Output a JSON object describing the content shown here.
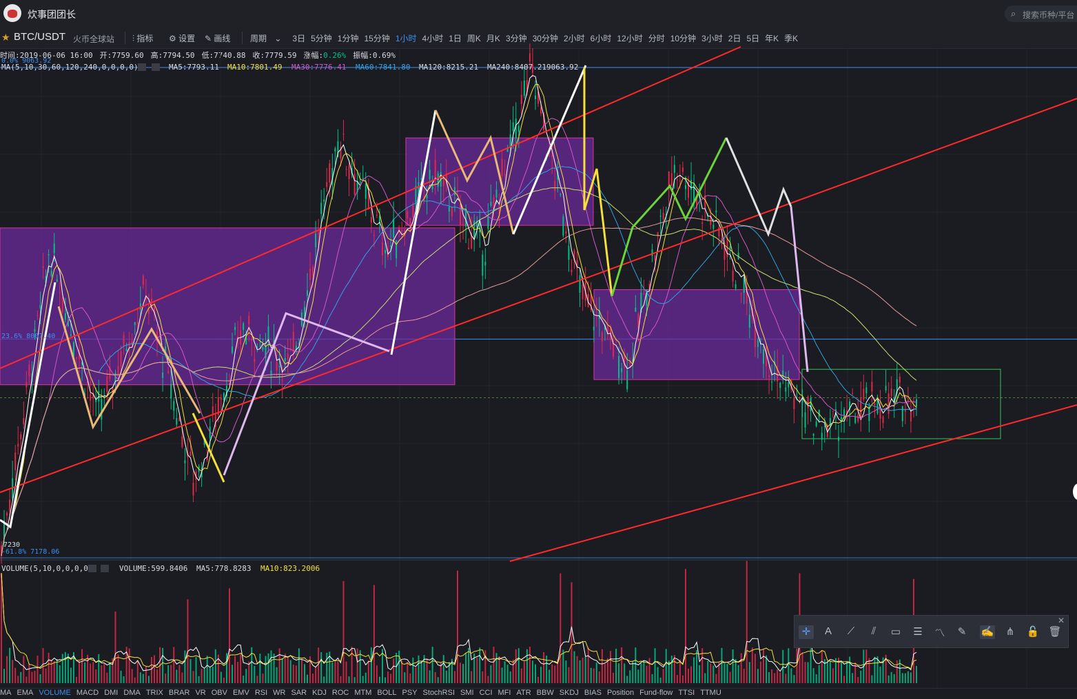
{
  "app": {
    "title": "炊事团团长",
    "search_placeholder": "搜索币种/平台"
  },
  "toolbar": {
    "pair": "BTC/USDT",
    "exchange": "火币全球站",
    "indicators_label": "指标",
    "settings_label": "设置",
    "draw_label": "画线",
    "period_label": "周期",
    "periods": [
      "3日",
      "5分钟",
      "1分钟",
      "15分钟",
      "1小时",
      "4小时",
      "1日",
      "周K",
      "月K",
      "3分钟",
      "30分钟",
      "2小时",
      "6小时",
      "12小时",
      "分时",
      "10分钟",
      "3小时",
      "2日",
      "5日",
      "年K",
      "季K"
    ],
    "active_period": "1小时"
  },
  "info": {
    "time": "时间:2019-06-06 16:00",
    "open_label": "开:",
    "open": "7759.60",
    "high_label": "高:",
    "high": "7794.50",
    "low_label": "低:",
    "low": "7740.88",
    "close_label": "收:",
    "close": "7779.59",
    "change_label": "涨幅:",
    "change": "0.26%",
    "amp_label": "振幅:",
    "amp": "0.69%",
    "ma_params": "MA(5,10,30,60,120,240,0,0,0,0)",
    "ma5": "MA5:7793.11",
    "ma10": "MA10:7801.49",
    "ma30": "MA30:7776.41",
    "ma60": "MA60:7841.80",
    "ma120": "MA120:8215.21",
    "ma240": "MA240:8407.21"
  },
  "levels": {
    "fib_top": "0.0% 9063.92",
    "top_price": "9063.92",
    "fib_mid": "23.6% 8007.40",
    "low_mark": "7230",
    "fib_bottom": "-61.8% 7178.06"
  },
  "volume": {
    "params": "VOLUME(5,10,0,0,0,0)",
    "volume": "VOLUME:599.8406",
    "ma5": "MA5:778.8283",
    "ma10": "MA10:823.2006"
  },
  "indicators": [
    "MA",
    "EMA",
    "VOLUME",
    "MACD",
    "DMI",
    "DMA",
    "TRIX",
    "BRAR",
    "VR",
    "OBV",
    "EMV",
    "RSI",
    "WR",
    "SAR",
    "KDJ",
    "ROC",
    "MTM",
    "BOLL",
    "PSY",
    "StochRSI",
    "SMI",
    "CCI",
    "MFI",
    "ATR",
    "BBW",
    "SKDJ",
    "BIAS",
    "Position",
    "Fund-flow",
    "TTSI",
    "TTMU"
  ],
  "active_indicator": "VOLUME",
  "colors": {
    "background": "#1a1c21",
    "up": "#03c087",
    "down": "#e0294a",
    "ma5": "#ffffff",
    "ma10": "#f5e03c",
    "ma30": "#d456c9",
    "ma60": "#2fa4e0",
    "ma120": "#c8e070",
    "ma240": "#e89a9a",
    "trend": "#ff2a2a",
    "zone": "#6b2a9c",
    "accent": "#3d8ff2"
  },
  "chart_data": {
    "type": "candlestick",
    "pair": "BTC/USDT",
    "interval": "1小时",
    "ohlc_last": {
      "open": 7759.6,
      "high": 7794.5,
      "low": 7740.88,
      "close": 7779.59
    },
    "moving_averages": {
      "MA5": 7793.11,
      "MA10": 7801.49,
      "MA30": 7776.41,
      "MA60": 7841.8,
      "MA120": 8215.21,
      "MA240": 8407.21
    },
    "y_range": [
      7178.06,
      9063.92
    ],
    "fib_levels": [
      {
        "level": "0.0%",
        "price": 9063.92
      },
      {
        "level": "23.6%",
        "price": 8007.4
      },
      {
        "level": "-61.8%",
        "price": 7178.06
      }
    ],
    "zones": [
      {
        "color": "purple",
        "price_top": 8440,
        "price_bottom": 7830
      },
      {
        "color": "purple",
        "price_top": 8790,
        "price_bottom": 8450
      },
      {
        "color": "purple",
        "price_top": 8200,
        "price_bottom": 7850
      },
      {
        "color": "green",
        "price_top": 7890,
        "price_bottom": 7620
      }
    ],
    "close_path": [
      7200,
      8350,
      7700,
      8200,
      7450,
      8050,
      7900,
      8800,
      8350,
      8650,
      8350,
      9063,
      8200,
      7900,
      8700,
      8400,
      7900,
      7650,
      7750,
      7780
    ],
    "volume_last": 599.8406,
    "volume_ma5": 778.8283,
    "volume_ma10": 823.2006
  }
}
